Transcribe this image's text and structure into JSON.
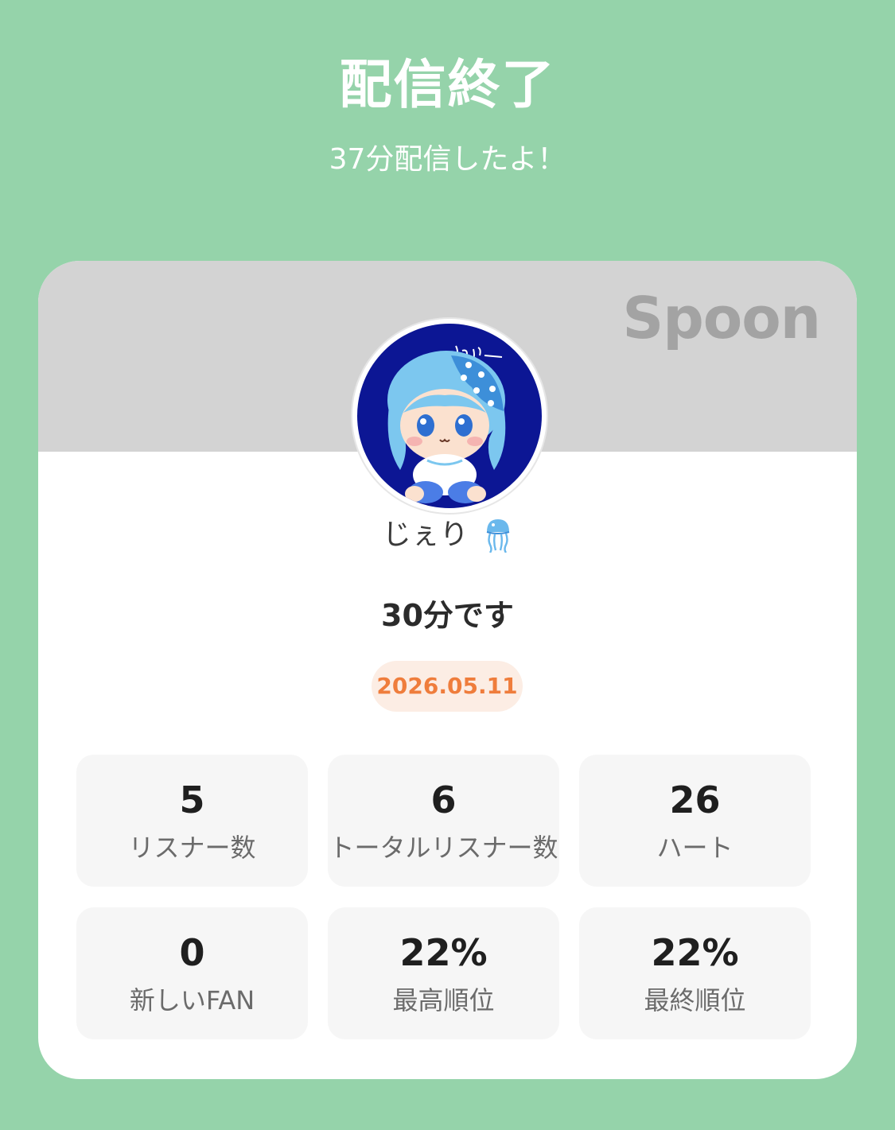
{
  "header": {
    "title": "配信終了",
    "subtitle": "37分配信したよ！"
  },
  "card": {
    "brand": "Spoon",
    "user": {
      "name": "じぇり",
      "emoji_icon": "jellyfish-icon",
      "avatar_text": "じぇり〜"
    },
    "duration": "30分です",
    "date": "2026.05.11",
    "stats": [
      {
        "value": "5",
        "label": "リスナー数"
      },
      {
        "value": "6",
        "label": "トータルリスナー数"
      },
      {
        "value": "26",
        "label": "ハート"
      },
      {
        "value": "0",
        "label": "新しいFAN"
      },
      {
        "value": "22%",
        "label": "最高順位"
      },
      {
        "value": "22%",
        "label": "最終順位"
      }
    ]
  },
  "colors": {
    "background": "#95d3aa",
    "card": "#ffffff",
    "card_header": "#d3d3d3",
    "date_accent": "#ef7d3c",
    "date_badge_bg": "#fcede4",
    "stat_box_bg": "#f6f6f6"
  }
}
